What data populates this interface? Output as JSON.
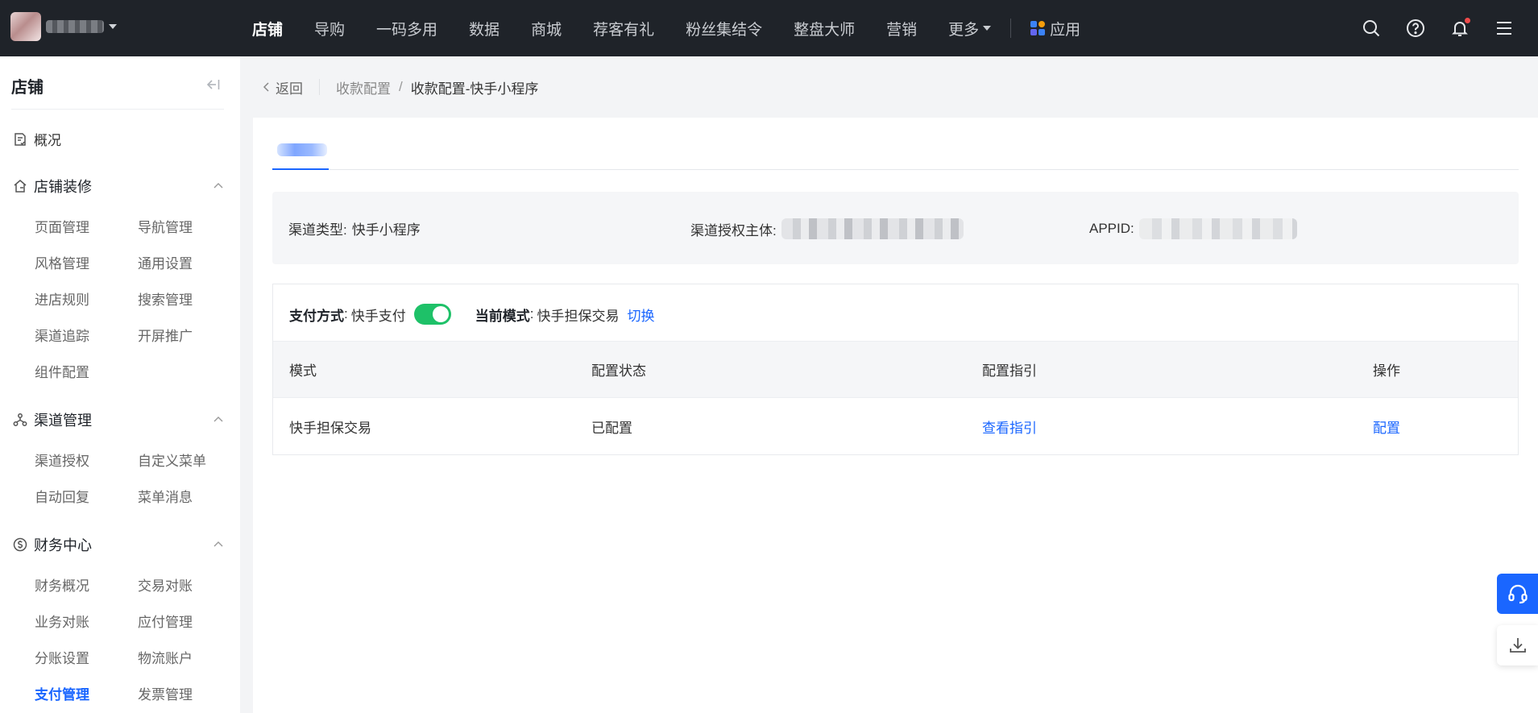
{
  "topbar": {
    "nav": [
      {
        "label": "店铺",
        "active": true
      },
      {
        "label": "导购"
      },
      {
        "label": "一码多用"
      },
      {
        "label": "数据"
      },
      {
        "label": "商城"
      },
      {
        "label": "荐客有礼"
      },
      {
        "label": "粉丝集结令"
      },
      {
        "label": "整盘大师"
      },
      {
        "label": "营销"
      }
    ],
    "more_label": "更多",
    "app_label": "应用",
    "icons": [
      "search-icon",
      "help-icon",
      "bell-icon",
      "menu-icon"
    ]
  },
  "sidebar": {
    "title": "店铺",
    "overview": "概况",
    "groups": [
      {
        "title": "店铺装修",
        "icon": "house-icon",
        "items": [
          "页面管理",
          "导航管理",
          "风格管理",
          "通用设置",
          "进店规则",
          "搜索管理",
          "渠道追踪",
          "开屏推广",
          "组件配置"
        ]
      },
      {
        "title": "渠道管理",
        "icon": "network-icon",
        "items": [
          "渠道授权",
          "自定义菜单",
          "自动回复",
          "菜单消息"
        ]
      },
      {
        "title": "财务中心",
        "icon": "dollar-circle-icon",
        "items": [
          "财务概况",
          "交易对账",
          "业务对账",
          "应付管理",
          "分账设置",
          "物流账户",
          "支付管理",
          "发票管理"
        ]
      }
    ],
    "active_item": "支付管理"
  },
  "breadcrumb": {
    "back": "返回",
    "parent": "收款配置",
    "separator": "/",
    "current": "收款配置-快手小程序"
  },
  "info": {
    "channel_type_label": "渠道类型:",
    "channel_type_value": "快手小程序",
    "auth_subject_label": "渠道授权主体:",
    "appid_label": "APPID:"
  },
  "payment": {
    "method_label": "支付方式",
    "method_value": "快手支付",
    "mode_label": "当前模式",
    "mode_value": "快手担保交易",
    "switch_link": "切换",
    "colon": ":",
    "toggle_on": true
  },
  "table": {
    "headers": [
      "模式",
      "配置状态",
      "配置指引",
      "操作"
    ],
    "rows": [
      {
        "mode": "快手担保交易",
        "status": "已配置",
        "guide": "查看指引",
        "action": "配置"
      }
    ]
  },
  "colors": {
    "accent": "#1a66ff",
    "topbar": "#1f2329",
    "toggle": "#1ec168"
  }
}
